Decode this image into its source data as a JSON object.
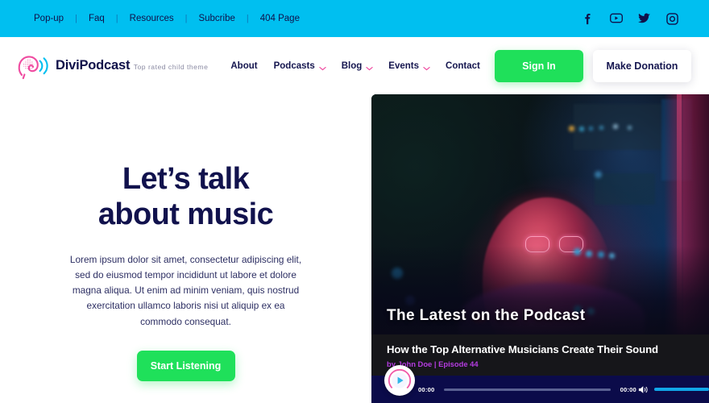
{
  "topbar": {
    "links": [
      "Pop-up",
      "Faq",
      "Resources",
      "Subcribe",
      "404 Page"
    ],
    "separator": "|",
    "social": [
      {
        "name": "facebook-icon",
        "label": "Facebook"
      },
      {
        "name": "youtube-icon",
        "label": "YouTube"
      },
      {
        "name": "twitter-icon",
        "label": "Twitter"
      },
      {
        "name": "instagram-icon",
        "label": "Instagram"
      }
    ],
    "bg_color": "#00bff0"
  },
  "header": {
    "brand_name": "DiviPodcast",
    "brand_tagline": "Top rated child theme",
    "logo_icon": "ear-soundwave-icon",
    "nav": [
      {
        "label": "About",
        "has_dropdown": false
      },
      {
        "label": "Podcasts",
        "has_dropdown": true
      },
      {
        "label": "Blog",
        "has_dropdown": true
      },
      {
        "label": "Events",
        "has_dropdown": true
      },
      {
        "label": "Contact",
        "has_dropdown": false
      }
    ],
    "signin_label": "Sign In",
    "donate_label": "Make Donation",
    "accent_green": "#1fe05a",
    "navy": "#15164f"
  },
  "hero": {
    "title_line1": "Let’s talk",
    "title_line2": "about music",
    "paragraph": "Lorem ipsum dolor sit amet, consectetur adipiscing elit, sed do eiusmod tempor incididunt ut labore et dolore magna aliqua. Ut enim ad minim veniam, quis nostrud exercitation ullamco laboris nisi ut aliquip ex ea commodo consequat.",
    "cta_label": "Start Listening"
  },
  "card": {
    "image_caption": "The Latest on the Podcast",
    "episode_title": "How the Top Alternative Musicians Create Their Sound",
    "episode_meta": "by John Doe | Episode 44",
    "meta_color": "#b43ce0",
    "player": {
      "play_icon": "play-icon",
      "current_time": "00:00",
      "duration": "00:00",
      "volume_icon": "volume-icon",
      "bg_color": "#0b0b4a",
      "volume_color": "#11a6e8"
    }
  }
}
